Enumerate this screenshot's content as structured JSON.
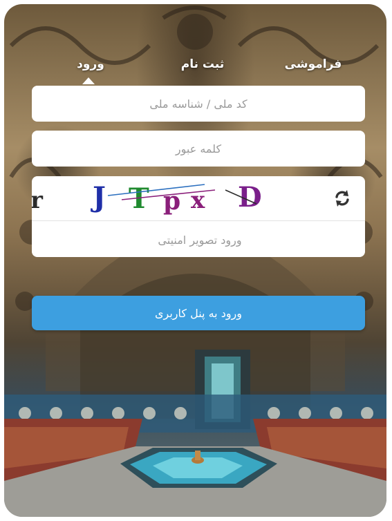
{
  "tabs": {
    "login": "ورود",
    "register": "ثبت نام",
    "forgot": "فراموشی",
    "active": "login"
  },
  "form": {
    "national_id_placeholder": "کد ملی / شناسه ملی",
    "password_placeholder": "کلمه عبور",
    "captcha_placeholder": "ورود تصویر امنیتی",
    "submit_label": "ورود به پنل کاربری"
  },
  "captcha": {
    "characters": [
      {
        "char": "r",
        "color": "#2b2b2b"
      },
      {
        "char": "J",
        "color": "#1f2fa8"
      },
      {
        "char": "T",
        "color": "#1f8a2f"
      },
      {
        "char": "p",
        "color": "#8a1f7a"
      },
      {
        "char": "x",
        "color": "#8a1f7a"
      },
      {
        "char": "D",
        "color": "#7a1f8a"
      }
    ]
  },
  "icons": {
    "refresh": "refresh-icon"
  },
  "colors": {
    "accent": "#3d9fe0",
    "field_bg": "#ffffff",
    "tab_text": "#ffffff"
  }
}
